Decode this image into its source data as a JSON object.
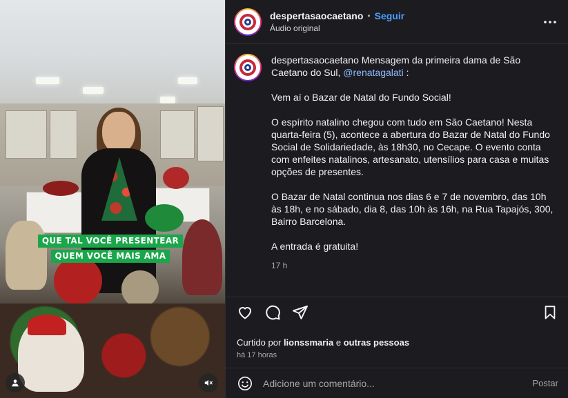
{
  "media": {
    "banner_line1": "QUE TAL VOCÊ PRESENTEAR",
    "banner_line2": "QUEM VOCÊ MAIS AMA",
    "user_tag_icon": "person-icon",
    "mute_icon": "muted-speaker-icon"
  },
  "header": {
    "username": "despertasaocaetano",
    "separator": "•",
    "follow_label": "Seguir",
    "audio_label": "Áudio original",
    "more_icon": "more-horizontal-icon"
  },
  "caption": {
    "username": "despertasaocaetano",
    "intro": "Mensagem da primeira dama de São Caetano do Sul,",
    "mention": "@renatagalati",
    "intro_end": ":",
    "paragraphs": [
      "Vem aí o Bazar de Natal do Fundo Social!",
      "O espírito natalino chegou com tudo em São Caetano! Nesta quarta-feira (5), acontece a abertura do Bazar de Natal do Fundo Social de Solidariedade, às 18h30, no Cecape. O evento conta com enfeites natalinos, artesanato, utensílios para casa e muitas opções de presentes.",
      "O Bazar de Natal continua nos dias 6 e 7 de novembro, das 10h às 18h, e no sábado, dia 8, das 10h às 16h, na Rua Tapajós, 300, Bairro Barcelona.",
      "A entrada é gratuita!"
    ],
    "time": "17 h"
  },
  "actions": {
    "like_icon": "heart-icon",
    "comment_icon": "comment-icon",
    "share_icon": "send-icon",
    "save_icon": "bookmark-icon",
    "liked_prefix": "Curtido por",
    "liked_user": "lionssmaria",
    "liked_and": "e",
    "liked_others": "outras pessoas",
    "ago": "há 17 horas"
  },
  "comment": {
    "emoji_icon": "emoji-icon",
    "placeholder": "Adicione um comentário...",
    "post_label": "Postar"
  },
  "colors": {
    "panel_bg": "#1c1c20",
    "link_blue": "#4a9dff",
    "mention_blue": "#8fb9ff",
    "banner_green": "#1aa64a"
  }
}
